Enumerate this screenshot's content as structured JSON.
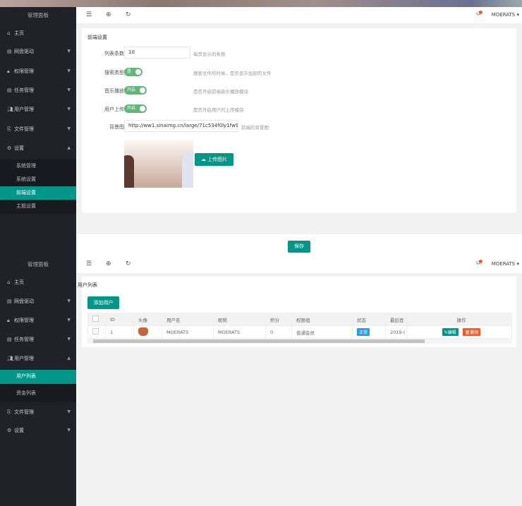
{
  "panel1": {
    "sidebar": {
      "title": "管理面板",
      "items": [
        {
          "label": "主页",
          "icon": "home-icon"
        },
        {
          "label": "网盘驱动",
          "icon": "list-icon"
        },
        {
          "label": "权限管理",
          "icon": "lock-icon"
        },
        {
          "label": "任务管理",
          "icon": "list-icon"
        },
        {
          "label": "用户管理",
          "icon": "users-icon"
        },
        {
          "label": "文件管理",
          "icon": "files-icon"
        },
        {
          "label": "设置",
          "icon": "gear-icon"
        }
      ],
      "subitems": [
        "系统管理",
        "系统设置",
        "前端设置",
        "主题设置"
      ],
      "active": "前端设置"
    },
    "header": {
      "user": "MOERATS"
    },
    "card": {
      "title": "前端设置",
      "rows": [
        {
          "label": "列表条数",
          "value": "10",
          "hint": "每页显示的条数"
        },
        {
          "label": "搜索类型",
          "switch": "是",
          "hint": "搜索文件的时候，是否显示加密的文件"
        },
        {
          "label": "音乐播放",
          "switch": "开启",
          "hint": "是否开启前端音乐播放模块"
        },
        {
          "label": "用户上传",
          "switch": "开启",
          "hint": "是否开启用户的上传模块"
        },
        {
          "label": "背景图",
          "value": "http://ww1.sinaimg.cn/large/71c534f0ly1fw9tw",
          "hint": "前端的背景图"
        }
      ],
      "upload": "上传图片"
    },
    "save": "保存"
  },
  "panel2": {
    "sidebar": {
      "title": "管理面板",
      "items": [
        {
          "label": "主页"
        },
        {
          "label": "网盘驱动"
        },
        {
          "label": "权限管理"
        },
        {
          "label": "任务管理"
        },
        {
          "label": "用户管理"
        },
        {
          "label": "文件管理"
        },
        {
          "label": "设置"
        }
      ],
      "subitems": [
        "用户列表",
        "资金列表"
      ],
      "active": "用户列表"
    },
    "header": {
      "user": "MOERATS"
    },
    "card": {
      "title": "用户列表",
      "add": "添加用户",
      "columns": [
        "ID",
        "头像",
        "用户名",
        "昵称",
        "积分",
        "权限组",
        "状态",
        "最后登",
        "操作"
      ],
      "rows": [
        {
          "id": "1",
          "username": "MOERATS",
          "nickname": "MOERATS",
          "points": "0",
          "group": "普通会员",
          "status": "正常",
          "last": "2019-(",
          "edit": "编辑",
          "delete": "删除"
        }
      ]
    }
  },
  "colors": {
    "accent": "#009688",
    "sidebar": "#20222a",
    "switch": "#5fb878",
    "danger": "#ff5722",
    "status": "#1e9fff"
  }
}
